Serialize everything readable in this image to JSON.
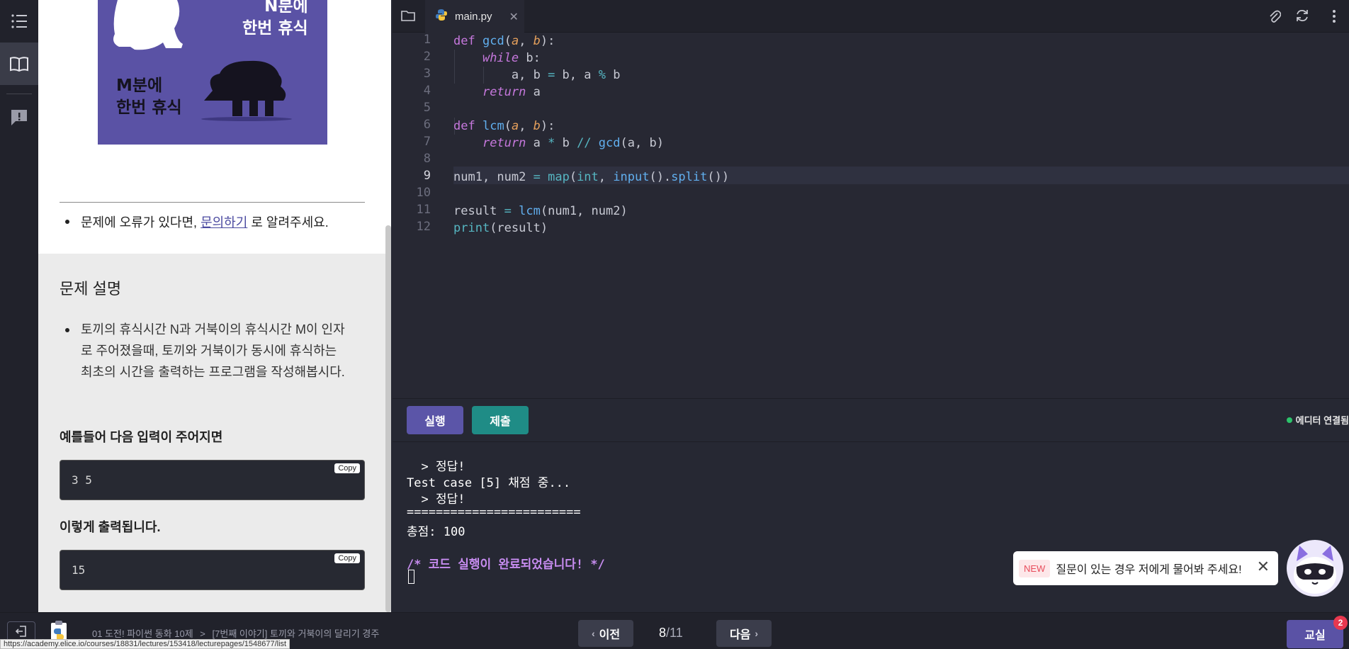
{
  "rail": {
    "icons": [
      "list-icon",
      "book-icon",
      "feedback-icon"
    ]
  },
  "problem": {
    "hero": {
      "rabbit_text_line1": "N분에",
      "rabbit_text_line2": "한번 휴식",
      "turtle_text_line1": "M분에",
      "turtle_text_line2": "한번 휴식"
    },
    "notice_prefix": "문제에 오류가 있다면,",
    "notice_link": "문의하기",
    "notice_suffix": "로 알려주세요.",
    "section_title": "문제 설명",
    "description": "토끼의 휴식시간 N과 거북이의 휴식시간 M이 인자로 주어졌을때, 토끼와 거북이가 동시에 휴식하는 최초의 시간을 출력하는 프로그램을 작성해봅시다.",
    "example_input_title": "예를들어 다음 입력이 주어지면",
    "example_input": "3 5",
    "example_output_title": "이렇게 출력됩니다.",
    "example_output": "15",
    "copy_label": "Copy"
  },
  "editor": {
    "tab_name": "main.py",
    "line_numbers": [
      "1",
      "2",
      "3",
      "4",
      "5",
      "6",
      "7",
      "8",
      "9",
      "10",
      "11",
      "12"
    ],
    "current_line": 9
  },
  "run": {
    "run_label": "실행",
    "submit_label": "제출",
    "status": "에디터 연결됨",
    "colors": {
      "run": "#5b55a8",
      "submit": "#1f8c86",
      "status_dot": "#2cc36b"
    }
  },
  "terminal": {
    "lines": [
      "  > 정답!",
      "Test case [5] 채점 중...",
      "  > 정답!",
      "========================",
      "총점: 100",
      "",
      "/* 코드 실행이 완료되었습니다! */"
    ]
  },
  "chat": {
    "new_tag": "NEW",
    "message": "질문이 있는 경우 저에게 물어봐 주세요!"
  },
  "bottom": {
    "breadcrumb_course": "01 도전! 파이썬 동화 10제",
    "breadcrumb_sep": ">",
    "breadcrumb_lecture": "[7번째 이야기] 토끼와 거북이의 달리기 경주",
    "prev_label": "이전",
    "next_label": "다음",
    "page_current": "8",
    "page_total": "/11",
    "classroom_label": "교실",
    "badge_count": "2",
    "url": "https://academy.elice.io/courses/18831/lectures/153418/lecturepages/1548677/list"
  }
}
